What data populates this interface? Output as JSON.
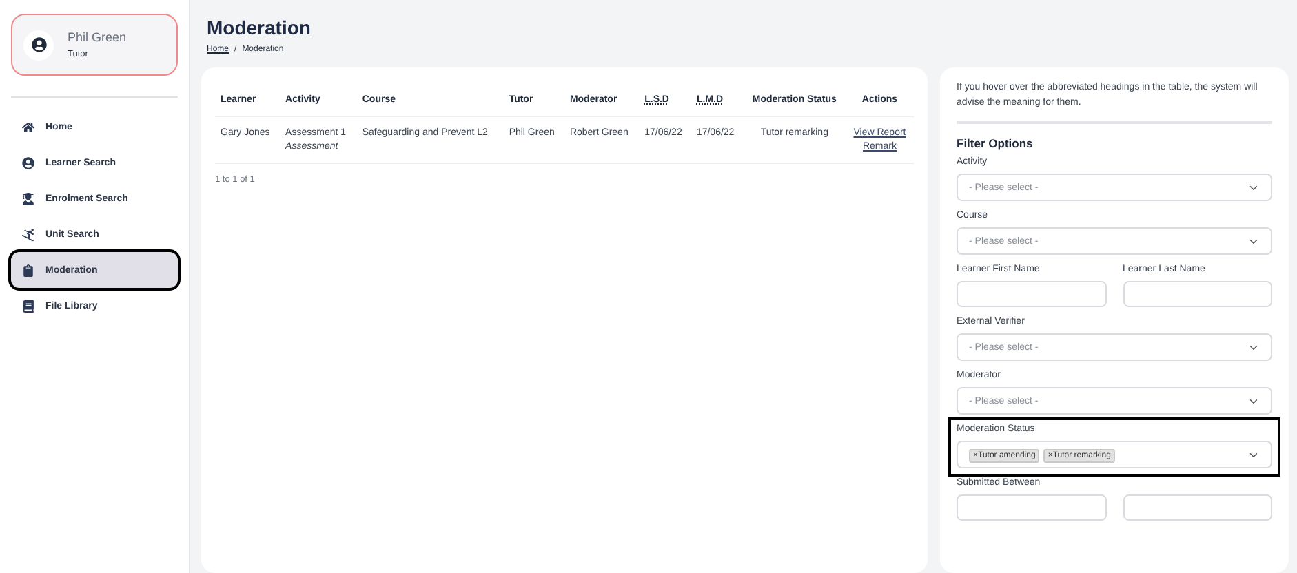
{
  "user": {
    "name": "Phil Green",
    "role": "Tutor"
  },
  "nav": [
    {
      "label": "Home",
      "selected": false,
      "highlighted": false
    },
    {
      "label": "Learner Search",
      "selected": false,
      "highlighted": false
    },
    {
      "label": "Enrolment Search",
      "selected": false,
      "highlighted": false
    },
    {
      "label": "Unit Search",
      "selected": false,
      "highlighted": false
    },
    {
      "label": "Moderation",
      "selected": true,
      "highlighted": true
    },
    {
      "label": "File Library",
      "selected": false,
      "highlighted": false
    }
  ],
  "page": {
    "title": "Moderation",
    "breadcrumb": [
      {
        "label": "Home",
        "link": true
      },
      {
        "label": "Moderation",
        "link": false
      }
    ],
    "separator": "/"
  },
  "table": {
    "columns": [
      {
        "label": "Learner",
        "abbr": false
      },
      {
        "label": "Activity",
        "abbr": false
      },
      {
        "label": "Course",
        "abbr": false
      },
      {
        "label": "Tutor",
        "abbr": false
      },
      {
        "label": "Moderator",
        "abbr": false
      },
      {
        "label": "L.S.D",
        "abbr": true
      },
      {
        "label": "L.M.D",
        "abbr": true
      },
      {
        "label": "Moderation Status",
        "abbr": false
      },
      {
        "label": "Actions",
        "abbr": false
      }
    ],
    "rows": [
      {
        "learner": "Gary Jones",
        "activity": "Assessment 1",
        "activity_type": "Assessment",
        "course": "Safeguarding and Prevent L2",
        "tutor": "Phil Green",
        "moderator": "Robert Green",
        "lsd": "17/06/22",
        "lmd": "17/06/22",
        "status": "Tutor remarking",
        "actions": [
          "View Report",
          "Remark"
        ]
      }
    ],
    "footer": "1 to 1 of 1"
  },
  "filters": {
    "info": "If you hover over the abbreviated headings in the table, the system will advise the meaning for them.",
    "title": "Filter Options",
    "fields": [
      {
        "kind": "select",
        "label": "Activity",
        "placeholder": "- Please select -",
        "highlighted": false
      },
      {
        "kind": "select",
        "label": "Course",
        "placeholder": "- Please select -",
        "highlighted": false
      },
      {
        "kind": "pair",
        "labels": [
          "Learner First Name",
          "Learner Last Name"
        ],
        "highlighted": false
      },
      {
        "kind": "select",
        "label": "External Verifier",
        "placeholder": "- Please select -",
        "highlighted": false
      },
      {
        "kind": "select",
        "label": "Moderator",
        "placeholder": "- Please select -",
        "highlighted": false
      },
      {
        "kind": "tags",
        "label": "Moderation Status",
        "tags": [
          "Tutor amending",
          "Tutor remarking"
        ],
        "remove": "×",
        "highlighted": true
      },
      {
        "kind": "pair",
        "label": "Submitted Between",
        "highlighted": false
      }
    ]
  }
}
